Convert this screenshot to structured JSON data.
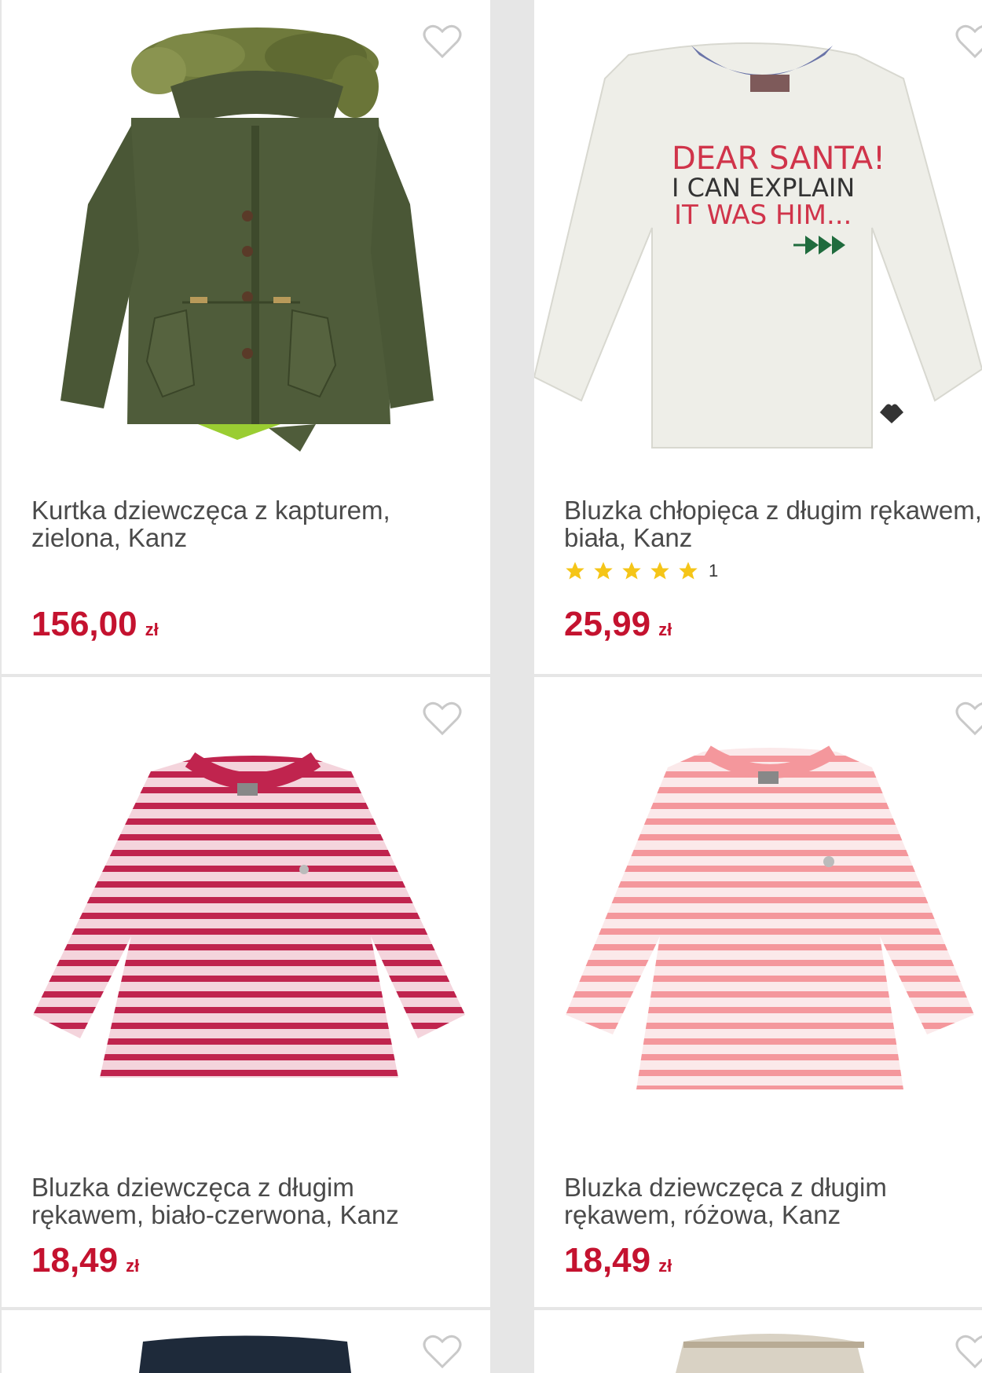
{
  "colors": {
    "price": "#c4122f",
    "star": "#f5c518",
    "background": "#e6e6e6"
  },
  "icons": {
    "favorite": "heart-outline-icon",
    "rating": "star-icon"
  },
  "products": [
    {
      "title": "Kurtka dziewczęca z kapturem, zielona, Kanz",
      "price": "156,00",
      "currency": "zł",
      "image": "green-parka-jacket"
    },
    {
      "title": "Bluzka chłopięca z długim rękawem, biała, Kanz",
      "price": "25,99",
      "currency": "zł",
      "rating_count": "1",
      "rating_stars": 5,
      "image": "white-longsleeve-shirt",
      "print_lines": [
        "DEAR SANTA!",
        "I CAN EXPLAIN",
        "IT WAS HIM..."
      ]
    },
    {
      "title": "Bluzka dziewczęca z długim rękawem, biało-czerwona, Kanz",
      "price": "18,49",
      "currency": "zł",
      "image": "red-white-striped-shirt"
    },
    {
      "title": "Bluzka dziewczęca z długim rękawem, różowa, Kanz",
      "price": "18,49",
      "currency": "zł",
      "image": "pink-striped-shirt"
    }
  ]
}
